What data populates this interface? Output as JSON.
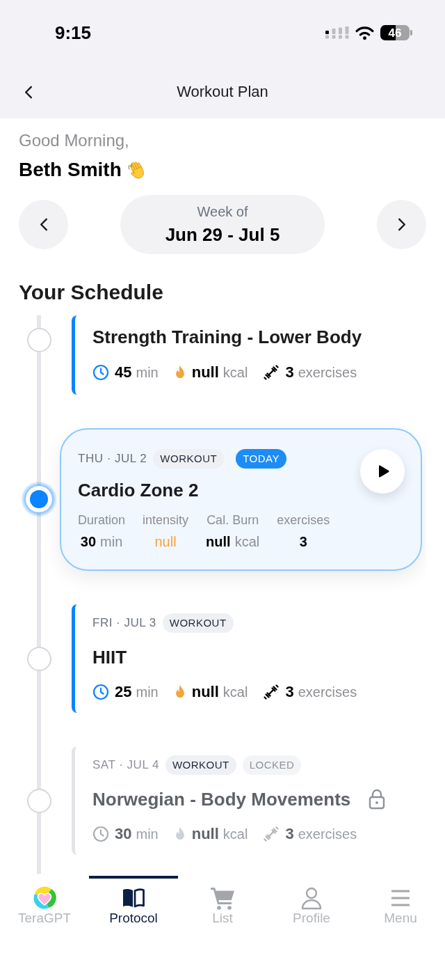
{
  "status_bar": {
    "time": "9:15",
    "battery": "46"
  },
  "header": {
    "title": "Workout Plan"
  },
  "greeting": {
    "salutation": "Good Morning,",
    "name": "Beth Smith"
  },
  "week_selector": {
    "label": "Week of",
    "range": "Jun 29 - Jul 5"
  },
  "schedule": {
    "title": "Your Schedule",
    "items": [
      {
        "kind": "compact",
        "selected": false,
        "locked": false,
        "title": "Strength Training - Lower Body",
        "stats": [
          {
            "kind": "duration",
            "value": "45",
            "unit": "min"
          },
          {
            "kind": "calories",
            "value": "null",
            "unit": "kcal"
          },
          {
            "kind": "exercises",
            "value": "3",
            "unit": "exercises"
          }
        ]
      },
      {
        "kind": "featured",
        "selected": true,
        "locked": false,
        "date": "THU · JUL 2",
        "badges": [
          {
            "kind": "type",
            "text": "WORKOUT"
          },
          {
            "kind": "today",
            "text": "TODAY"
          }
        ],
        "title": "Cardio Zone 2",
        "stats": [
          {
            "kind": "duration",
            "label": "Duration",
            "value": "30",
            "unit": "min"
          },
          {
            "kind": "intensity",
            "label": "intensity",
            "value": "null"
          },
          {
            "kind": "calories",
            "label": "Cal. Burn",
            "value": "null",
            "unit": "kcal"
          },
          {
            "kind": "exercises",
            "label": "exercises",
            "value": "3"
          }
        ]
      },
      {
        "kind": "compact",
        "selected": false,
        "locked": false,
        "date": "FRI · JUL 3",
        "badges": [
          {
            "kind": "type",
            "text": "WORKOUT"
          }
        ],
        "title": "HIIT",
        "stats": [
          {
            "kind": "duration",
            "value": "25",
            "unit": "min"
          },
          {
            "kind": "calories",
            "value": "null",
            "unit": "kcal"
          },
          {
            "kind": "exercises",
            "value": "3",
            "unit": "exercises"
          }
        ]
      },
      {
        "kind": "compact",
        "selected": false,
        "locked": true,
        "date": "SAT · JUL 4",
        "badges": [
          {
            "kind": "type",
            "text": "WORKOUT"
          },
          {
            "kind": "locked",
            "text": "LOCKED"
          }
        ],
        "title": "Norwegian - Body Movements",
        "stats": [
          {
            "kind": "duration",
            "value": "30",
            "unit": "min"
          },
          {
            "kind": "calories",
            "value": "null",
            "unit": "kcal"
          },
          {
            "kind": "exercises",
            "value": "3",
            "unit": "exercises"
          }
        ]
      }
    ]
  },
  "tab_bar": {
    "tabs": [
      {
        "label": "TeraGPT",
        "selected": false
      },
      {
        "label": "Protocol",
        "selected": true
      },
      {
        "label": "List",
        "selected": false
      },
      {
        "label": "Profile",
        "selected": false
      },
      {
        "label": "Menu",
        "selected": false
      }
    ]
  }
}
